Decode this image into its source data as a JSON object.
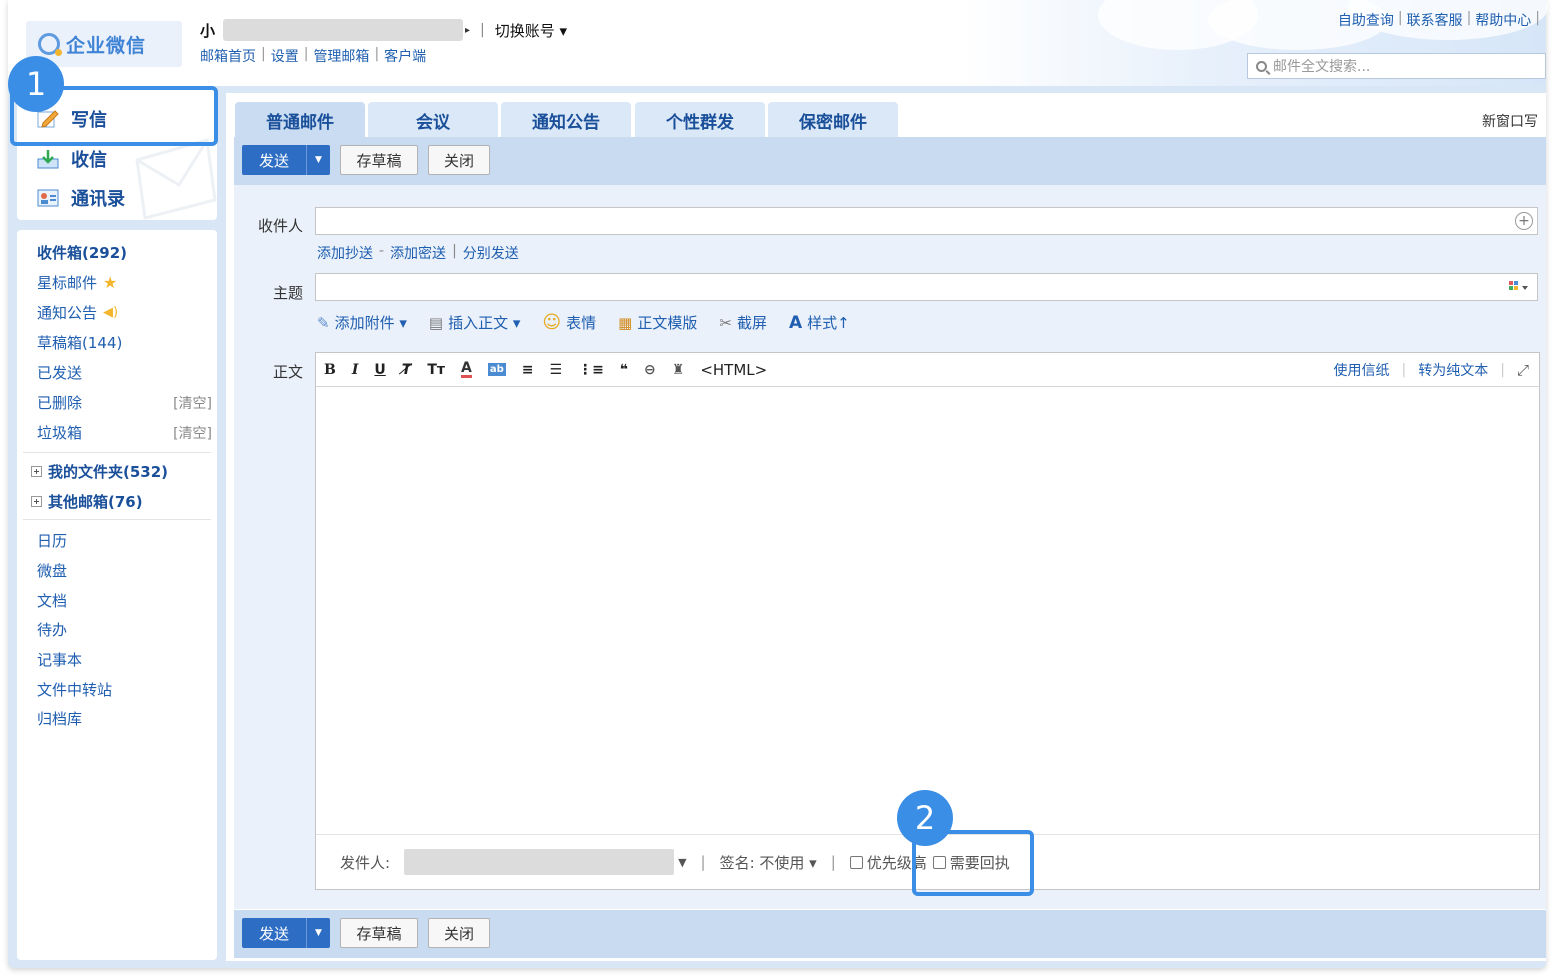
{
  "header": {
    "logo_text": "企业微信",
    "account_name": "小",
    "account_sep": "|",
    "switch_label": "切换账号 ▾",
    "top_links": [
      "邮箱首页",
      "设置",
      "管理邮箱",
      "客户端"
    ],
    "help_links": [
      "自助查询",
      "联系客服",
      "帮助中心"
    ],
    "search_placeholder": "邮件全文搜索..."
  },
  "nav": {
    "write": "写信",
    "inbox": "收信",
    "contacts": "通讯录"
  },
  "folders": {
    "inbox": "收件箱(292)",
    "starred": "星标邮件",
    "notice": "通知公告",
    "drafts": "草稿箱(144)",
    "sent": "已发送",
    "deleted": "已删除",
    "spam": "垃圾箱",
    "clear_label": "[清空]",
    "my_folders": "我的文件夹(532)",
    "other_mailboxes": "其他邮箱(76)",
    "apps": [
      "日历",
      "微盘",
      "文档",
      "待办",
      "记事本",
      "文件中转站",
      "归档库"
    ]
  },
  "tabs": [
    "普通邮件",
    "会议",
    "通知公告",
    "个性群发",
    "保密邮件"
  ],
  "new_window": "新窗口写",
  "toolbar": {
    "send": "发送",
    "save_draft": "存草稿",
    "close": "关闭"
  },
  "compose": {
    "to_label": "收件人",
    "to_value": "",
    "cc_links": [
      "添加抄送",
      "添加密送",
      "分别发送"
    ],
    "cc_sep": "-",
    "subject_label": "主题",
    "subject_value": "",
    "attach_items": [
      "添加附件 ▾",
      "插入正文 ▾",
      "表情",
      "正文模版",
      "截屏",
      "样式↑"
    ],
    "body_label": "正文",
    "html_label": "<HTML>",
    "stationery": "使用信纸",
    "plain_text": "转为纯文本",
    "sender_label": "发件人:",
    "signature_label": "签名: 不使用 ▾",
    "priority_label": "优先级高",
    "receipt_label": "需要回执"
  },
  "annotations": {
    "step1": "1",
    "step2": "2"
  },
  "colors": {
    "accent": "#3a8ee6",
    "link": "#1f5eb0",
    "send_button": "#2d6dc4"
  }
}
